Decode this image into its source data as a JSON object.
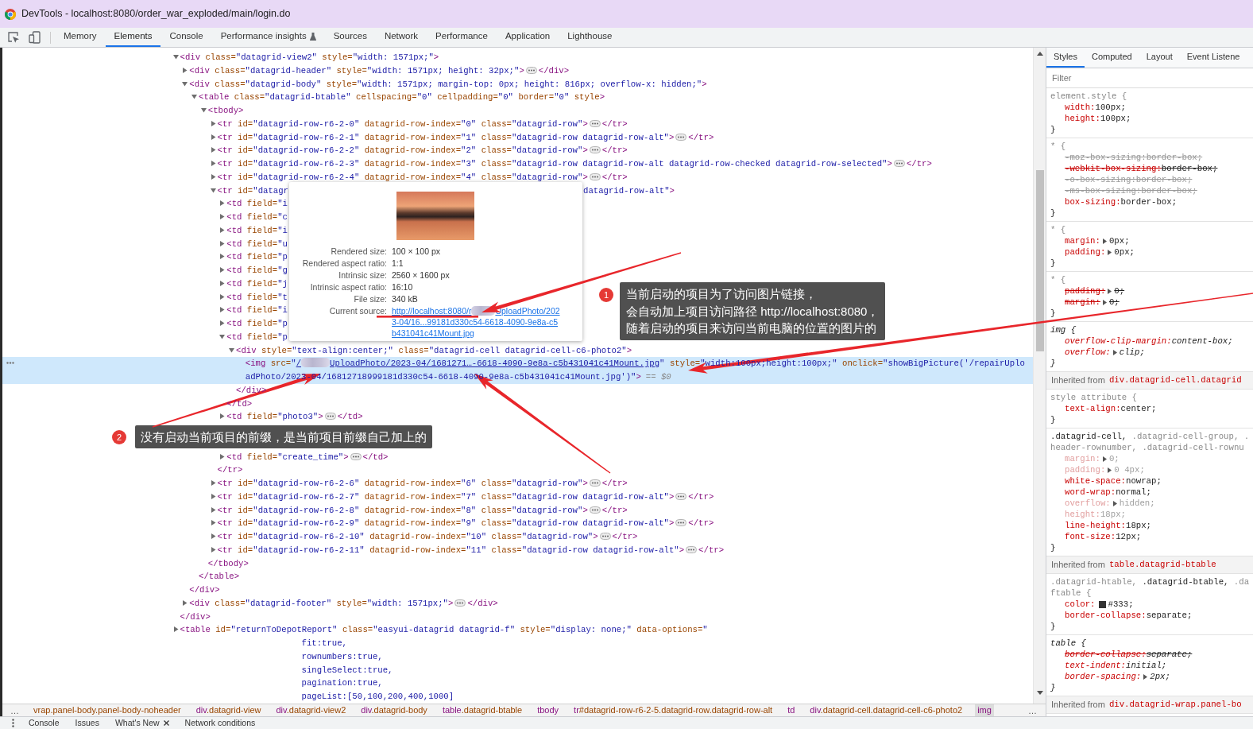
{
  "window": {
    "title": "DevTools - localhost:8080/order_war_exploded/main/login.do"
  },
  "toolbar": {
    "tabs": [
      {
        "label": "Memory",
        "selected": false,
        "kind": "plain"
      },
      {
        "label": "Elements",
        "selected": true,
        "kind": "plain"
      },
      {
        "label": "Console",
        "selected": false,
        "kind": "plain"
      },
      {
        "label": "Performance insights",
        "selected": false,
        "kind": "experimental"
      },
      {
        "label": "Sources",
        "selected": false,
        "kind": "plain"
      },
      {
        "label": "Network",
        "selected": false,
        "kind": "plain"
      },
      {
        "label": "Performance",
        "selected": false,
        "kind": "plain"
      },
      {
        "label": "Application",
        "selected": false,
        "kind": "plain"
      },
      {
        "label": "Lighthouse",
        "selected": false,
        "kind": "plain"
      }
    ]
  },
  "elements": {
    "tree": [
      {
        "open_tag": "<div class=\"datagrid-view2\" style=\"width: 1571px;\">",
        "expanded": true,
        "selected": false,
        "children": [
          {
            "open_tag": "<div class=\"datagrid-header\" style=\"width: 1571px; height: 32px;\">",
            "expanded": false,
            "selected": false,
            "close_tag": "</div>"
          },
          {
            "open_tag": "<div class=\"datagrid-body\" style=\"width: 1571px; margin-top: 0px; height: 816px; overflow-x: hidden;\">",
            "expanded": true,
            "selected": false,
            "children": [
              {
                "open_tag": "<table class=\"datagrid-btable\" cellspacing=\"0\" cellpadding=\"0\" border=\"0\" style>",
                "expanded": true,
                "selected": false,
                "children": [
                  {
                    "open_tag": "<tbody>",
                    "expanded": true,
                    "selected": false,
                    "children": [
                      {
                        "open_tag": "<tr id=\"datagrid-row-r6-2-0\" datagrid-row-index=\"0\" class=\"datagrid-row\">",
                        "expanded": false,
                        "selected": false,
                        "close_tag": "</tr>"
                      },
                      {
                        "open_tag": "<tr id=\"datagrid-row-r6-2-1\" datagrid-row-index=\"1\" class=\"datagrid-row datagrid-row-alt\">",
                        "expanded": false,
                        "selected": false,
                        "close_tag": "</tr>"
                      },
                      {
                        "open_tag": "<tr id=\"datagrid-row-r6-2-2\" datagrid-row-index=\"2\" class=\"datagrid-row\">",
                        "expanded": false,
                        "selected": false,
                        "close_tag": "</tr>"
                      },
                      {
                        "open_tag": "<tr id=\"datagrid-row-r6-2-3\" datagrid-row-index=\"3\" class=\"datagrid-row datagrid-row-alt datagrid-row-checked datagrid-row-selected\">",
                        "expanded": false,
                        "selected": false,
                        "close_tag": "</tr>"
                      },
                      {
                        "open_tag": "<tr id=\"datagrid-row-r6-2-4\" datagrid-row-index=\"4\" class=\"datagrid-row\">",
                        "expanded": false,
                        "selected": false,
                        "close_tag": "</tr>"
                      },
                      {
                        "open_tag": "<tr id=\"datagr",
                        "open_tag_end": "datagrid-row-alt\">",
                        "expanded": true,
                        "selected": false,
                        "children": [
                          {
                            "open_tag": "<td field=\"i",
                            "expanded": false,
                            "selected": false
                          },
                          {
                            "open_tag": "<td field=\"c",
                            "expanded": false,
                            "selected": false
                          },
                          {
                            "open_tag": "<td field=\"i",
                            "expanded": false,
                            "selected": false
                          },
                          {
                            "open_tag": "<td field=\"u",
                            "expanded": false,
                            "selected": false
                          },
                          {
                            "open_tag": "<td field=\"p",
                            "expanded": false,
                            "selected": false
                          },
                          {
                            "open_tag": "<td field=\"g",
                            "expanded": false,
                            "selected": false
                          },
                          {
                            "open_tag": "<td field=\"j",
                            "expanded": false,
                            "selected": false
                          },
                          {
                            "open_tag": "<td field=\"t",
                            "expanded": false,
                            "selected": false
                          },
                          {
                            "open_tag": "<td field=\"i",
                            "expanded": false,
                            "selected": false
                          },
                          {
                            "open_tag": "<td field=\"p",
                            "expanded": false,
                            "selected": false
                          },
                          {
                            "open_tag": "<td field=\"p",
                            "expanded": true,
                            "selected": false,
                            "children": [
                              {
                                "open_tag": "<div style=\"text-align:center;\" class=\"datagrid-cell datagrid-cell-c6-photo2\">",
                                "expanded": true,
                                "selected": false,
                                "children": [
                                  {
                                    "kind": "image",
                                    "open_tag_start": "<img src=\"",
                                    "src_before_blur": "/",
                                    "src_after_blur": "UploadPhoto/2023-04/1681271…-6618-4090-9e8a-c5b431041c41Mount.jpg",
                                    "open_tag_rest": [
                                      "\" style=\"width:100px;height:100px;\" onclick=\"showBigPicture('/repairUplo",
                                      "adPhoto/2023-04/16812718999181d330c54-6618-4090-9e8a-c5b431041c41Mount.jpg')\">"
                                    ],
                                    "console_ref": "== $0",
                                    "selected": true
                                  }
                                ],
                                "close_tag": "</div>"
                              }
                            ],
                            "close_tag": "</td>"
                          },
                          {
                            "open_tag": "<td field=\"photo3\">",
                            "expanded": false,
                            "selected": false,
                            "close_tag": "</td>"
                          },
                          {
                            "kind": "annotation",
                            "number": "2",
                            "text": "没有启动当前项目的前缀，是当前项目前缀自己加上的"
                          },
                          {
                            "open_tag": "<td field=\"create_time\">",
                            "expanded": false,
                            "selected": false,
                            "close_tag": "</td>"
                          }
                        ],
                        "close_tag": "</tr>"
                      },
                      {
                        "open_tag": "<tr id=\"datagrid-row-r6-2-6\" datagrid-row-index=\"6\" class=\"datagrid-row\">",
                        "expanded": false,
                        "selected": false,
                        "close_tag": "</tr>"
                      },
                      {
                        "open_tag": "<tr id=\"datagrid-row-r6-2-7\" datagrid-row-index=\"7\" class=\"datagrid-row datagrid-row-alt\">",
                        "expanded": false,
                        "selected": false,
                        "close_tag": "</tr>"
                      },
                      {
                        "open_tag": "<tr id=\"datagrid-row-r6-2-8\" datagrid-row-index=\"8\" class=\"datagrid-row\">",
                        "expanded": false,
                        "selected": false,
                        "close_tag": "</tr>"
                      },
                      {
                        "open_tag": "<tr id=\"datagrid-row-r6-2-9\" datagrid-row-index=\"9\" class=\"datagrid-row datagrid-row-alt\">",
                        "expanded": false,
                        "selected": false,
                        "close_tag": "</tr>"
                      },
                      {
                        "open_tag": "<tr id=\"datagrid-row-r6-2-10\" datagrid-row-index=\"10\" class=\"datagrid-row\">",
                        "expanded": false,
                        "selected": false,
                        "close_tag": "</tr>"
                      },
                      {
                        "open_tag": "<tr id=\"datagrid-row-r6-2-11\" datagrid-row-index=\"11\" class=\"datagrid-row datagrid-row-alt\">",
                        "expanded": false,
                        "selected": false,
                        "close_tag": "</tr>"
                      }
                    ],
                    "close_tag": "</tbody>"
                  }
                ],
                "close_tag": "</table>"
              }
            ],
            "close_tag": "</div>"
          },
          {
            "open_tag": "<div class=\"datagrid-footer\" style=\"width: 1571px;\">",
            "expanded": false,
            "selected": false,
            "close_tag": "</div>"
          }
        ],
        "close_tag": "</div>"
      },
      {
        "open_tag": "<table id=\"returnToDepotReport\" class=\"easyui-datagrid datagrid-f\" style=\"display: none;\" data-options=\"",
        "continuation": [
          "fit:true,",
          "rownumbers:true,",
          "singleSelect:true,",
          "pagination:true,",
          "pageList:[50,100,200,400,1000]"
        ],
        "expanded": false,
        "selected": false
      }
    ],
    "tooltip": {
      "rows": [
        {
          "kind": "text",
          "label": "Rendered size:",
          "value": "100 × 100 px"
        },
        {
          "kind": "text",
          "label": "Rendered aspect ratio:",
          "value": "1:1"
        },
        {
          "kind": "text",
          "label": "Intrinsic size:",
          "value": "2560 × 1600 px"
        },
        {
          "kind": "text",
          "label": "Intrinsic aspect ratio:",
          "value": "16:10"
        },
        {
          "kind": "text",
          "label": "File size:",
          "value": "340 kB"
        },
        {
          "kind": "link",
          "label": "Current source:",
          "value_before_blur": "http://localhost:8080/r",
          "value_after_blur": "UploadPhoto/202",
          "value_more_lines": [
            "3-04/16...99181d330c54-6618-4090-9e8a-c5",
            "b431041c41Mount.jpg"
          ]
        }
      ]
    },
    "breadcrumbs": {
      "overflow_left": "…",
      "items": [
        {
          "rest": "vrap.panel-body.panel-body-noheader",
          "selected": false
        },
        {
          "tag": "div",
          "rest": ".datagrid-view",
          "selected": false
        },
        {
          "tag": "div",
          "rest": ".datagrid-view2",
          "selected": false
        },
        {
          "tag": "div",
          "rest": ".datagrid-body",
          "selected": false
        },
        {
          "tag": "table",
          "rest": ".datagrid-btable",
          "selected": false
        },
        {
          "tag": "tbody",
          "selected": false
        },
        {
          "tag": "tr",
          "rest": "#datagrid-row-r6-2-5.datagrid-row.datagrid-row-alt",
          "selected": false
        },
        {
          "tag": "td",
          "selected": false
        },
        {
          "tag": "div",
          "rest": ".datagrid-cell.datagrid-cell-c6-photo2",
          "selected": false
        },
        {
          "tag": "img",
          "selected": true
        }
      ],
      "overflow_right": "…"
    }
  },
  "styles": {
    "tabs": [
      {
        "label": "Styles",
        "selected": true
      },
      {
        "label": "Computed",
        "selected": false
      },
      {
        "label": "Layout",
        "selected": false
      },
      {
        "label": "Event Listene",
        "selected": false
      }
    ],
    "filter": {
      "placeholder": "Filter"
    },
    "sections": [
      {
        "kind": "rule",
        "user_agent": false,
        "selector_lines": [
          [
            {
              "text": "element.style {",
              "matched": false
            }
          ]
        ],
        "declarations": [
          {
            "name": "width:",
            "value": "100px;",
            "struck": false,
            "inactive": false,
            "expandable": false
          },
          {
            "name": "height:",
            "value": "100px;",
            "struck": false,
            "inactive": false,
            "expandable": false
          }
        ],
        "close": "}"
      },
      {
        "kind": "rule",
        "user_agent": false,
        "selector_lines": [
          [
            {
              "text": "* {",
              "matched": false
            }
          ]
        ],
        "declarations": [
          {
            "name": "-moz-box-sizing:",
            "value": "border-box;",
            "struck": true,
            "inactive": true,
            "expandable": false
          },
          {
            "name": "-webkit-box-sizing:",
            "value": "border-box;",
            "struck": true,
            "inactive": false,
            "expandable": false
          },
          {
            "name": "-o-box-sizing:",
            "value": "border-box;",
            "struck": true,
            "inactive": true,
            "expandable": false
          },
          {
            "name": "-ms-box-sizing:",
            "value": "border-box;",
            "struck": true,
            "inactive": true,
            "expandable": false
          },
          {
            "name": "box-sizing:",
            "value": "border-box;",
            "struck": false,
            "inactive": false,
            "expandable": false
          }
        ],
        "close": "}"
      },
      {
        "kind": "rule",
        "user_agent": false,
        "selector_lines": [
          [
            {
              "text": "* {",
              "matched": false
            }
          ]
        ],
        "declarations": [
          {
            "name": "margin:",
            "value": "0px;",
            "struck": false,
            "inactive": false,
            "expandable": true
          },
          {
            "name": "padding:",
            "value": "0px;",
            "struck": false,
            "inactive": false,
            "expandable": true
          }
        ],
        "close": "}"
      },
      {
        "kind": "rule",
        "user_agent": false,
        "selector_lines": [
          [
            {
              "text": "* {",
              "matched": false
            }
          ]
        ],
        "declarations": [
          {
            "name": "padding:",
            "value": "0;",
            "struck": true,
            "inactive": false,
            "expandable": true
          },
          {
            "name": "margin:",
            "value": "0;",
            "struck": true,
            "inactive": false,
            "expandable": true
          }
        ],
        "close": "}"
      },
      {
        "kind": "rule",
        "user_agent": true,
        "selector_lines": [
          [
            {
              "text": "img {",
              "matched": true
            }
          ]
        ],
        "declarations": [
          {
            "name": "overflow-clip-margin:",
            "value": "content-box;",
            "struck": false,
            "inactive": false,
            "expandable": false
          },
          {
            "name": "overflow:",
            "value": "clip;",
            "struck": false,
            "inactive": false,
            "expandable": true
          }
        ],
        "close": "}"
      },
      {
        "kind": "inherited",
        "label": "Inherited from",
        "selector": "div.datagrid-cell.datagrid"
      },
      {
        "kind": "rule",
        "user_agent": false,
        "selector_lines": [
          [
            {
              "text": "style attribute {",
              "matched": false
            }
          ]
        ],
        "declarations": [
          {
            "name": "text-align:",
            "value": "center;",
            "struck": false,
            "inactive": false,
            "expandable": false
          }
        ],
        "close": "}"
      },
      {
        "kind": "rule",
        "user_agent": false,
        "selector_lines": [
          [
            {
              "text": ".datagrid-cell,",
              "matched": true
            },
            {
              "text": ".datagrid-cell-group, .",
              "matched": false
            }
          ],
          [
            {
              "text": "header-rownumber, .datagrid-cell-rownu",
              "matched": false
            }
          ]
        ],
        "declarations": [
          {
            "name": "margin:",
            "value": "0;",
            "struck": false,
            "inactive": true,
            "expandable": true
          },
          {
            "name": "padding:",
            "value": "0 4px;",
            "struck": false,
            "inactive": true,
            "expandable": true
          },
          {
            "name": "white-space:",
            "value": "nowrap;",
            "struck": false,
            "inactive": false,
            "expandable": false
          },
          {
            "name": "word-wrap:",
            "value": "normal;",
            "struck": false,
            "inactive": false,
            "expandable": false
          },
          {
            "name": "overflow:",
            "value": "hidden;",
            "struck": false,
            "inactive": true,
            "expandable": true
          },
          {
            "name": "height:",
            "value": "18px;",
            "struck": false,
            "inactive": true,
            "expandable": false
          },
          {
            "name": "line-height:",
            "value": "18px;",
            "struck": false,
            "inactive": false,
            "expandable": false
          },
          {
            "name": "font-size:",
            "value": "12px;",
            "struck": false,
            "inactive": false,
            "expandable": false
          }
        ],
        "close": "}"
      },
      {
        "kind": "inherited",
        "label": "Inherited from",
        "selector": "table.datagrid-btable"
      },
      {
        "kind": "rule",
        "user_agent": false,
        "selector_lines": [
          [
            {
              "text": ".datagrid-htable,",
              "matched": false
            },
            {
              "text": ".datagrid-btable,",
              "matched": true
            },
            {
              "text": ".da",
              "matched": false
            }
          ],
          [
            {
              "text": "ftable {",
              "matched": false
            }
          ]
        ],
        "declarations": [
          {
            "name": "color:",
            "value": "#333;",
            "struck": false,
            "inactive": false,
            "expandable": false,
            "color": "#333333"
          },
          {
            "name": "border-collapse:",
            "value": "separate;",
            "struck": false,
            "inactive": false,
            "expandable": false
          }
        ],
        "close": "}"
      },
      {
        "kind": "rule",
        "user_agent": true,
        "selector_lines": [
          [
            {
              "text": "table {",
              "matched": true
            }
          ]
        ],
        "declarations": [
          {
            "name": "border-collapse:",
            "value": "separate;",
            "struck": true,
            "inactive": false,
            "expandable": false
          },
          {
            "name": "text-indent:",
            "value": "initial;",
            "struck": false,
            "inactive": false,
            "expandable": false
          },
          {
            "name": "border-spacing:",
            "value": "2px;",
            "struck": false,
            "inactive": false,
            "expandable": true
          }
        ],
        "close": "}"
      },
      {
        "kind": "inherited",
        "label": "Inherited from",
        "selector": "div.datagrid-wrap.panel-bo"
      }
    ]
  },
  "drawer": {
    "tabs": [
      {
        "label": "Console",
        "closable": false
      },
      {
        "label": "Issues",
        "closable": false
      },
      {
        "label": "What's New",
        "closable": true
      },
      {
        "label": "Network conditions",
        "closable": false
      }
    ]
  },
  "annotations": [
    {
      "number": "1",
      "lines": [
        "当前启动的项目为了访问图片链接，",
        "会自动加上项目访问路径 http://localhost:8080，",
        "随着启动的项目来访问当前电脑的位置的图片的"
      ]
    }
  ]
}
